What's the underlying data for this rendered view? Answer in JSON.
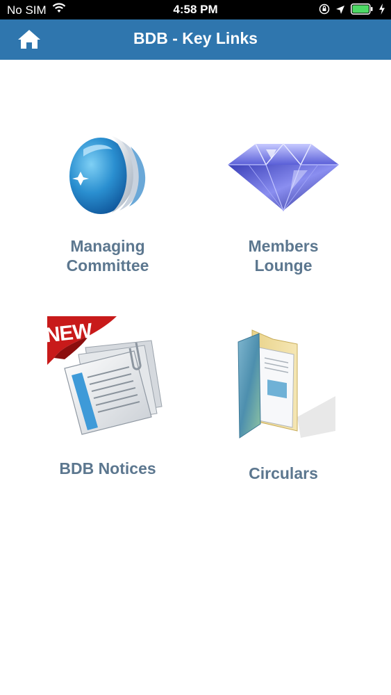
{
  "status_bar": {
    "carrier": "No SIM",
    "time": "4:58 PM",
    "icons": [
      "wifi-icon",
      "orientation-lock-icon",
      "location-icon",
      "battery-icon",
      "charging-icon"
    ]
  },
  "nav": {
    "title": "BDB - Key Links",
    "home_icon": "home-icon"
  },
  "tiles": [
    {
      "label": "Managing\nCommittee",
      "icon": "globe-logo-icon"
    },
    {
      "label": "Members\nLounge",
      "icon": "diamond-icon"
    },
    {
      "label": "BDB Notices",
      "icon": "notices-document-icon",
      "badge": "NEW"
    },
    {
      "label": "Circulars",
      "icon": "folder-icon"
    }
  ],
  "colors": {
    "navbar": "#2f76ae",
    "label": "#5c778f",
    "statusbar": "#000000",
    "battery": "#4cd964"
  }
}
